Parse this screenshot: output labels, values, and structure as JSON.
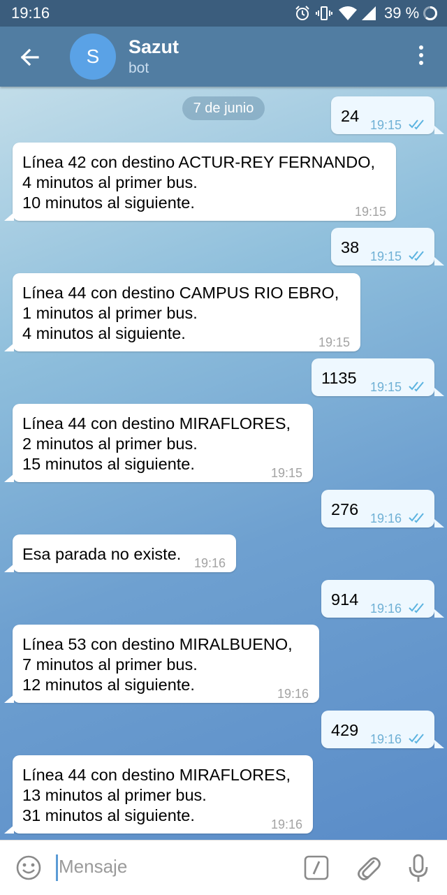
{
  "status_bar": {
    "time": "19:16",
    "battery": "39 %"
  },
  "header": {
    "avatar_letter": "S",
    "title": "Sazut",
    "subtitle": "bot"
  },
  "date_separator": "7 de junio",
  "messages": [
    {
      "dir": "out",
      "text": "24",
      "time": "19:15",
      "read": true
    },
    {
      "dir": "in",
      "text": "Línea 42 con destino ACTUR-REY FERNANDO,\n4 minutos al primer bus.\n10 minutos al siguiente.",
      "time": "19:15"
    },
    {
      "dir": "out",
      "text": "38",
      "time": "19:15",
      "read": true
    },
    {
      "dir": "in",
      "text": "Línea 44 con destino CAMPUS RIO EBRO,\n1 minutos al primer bus.\n4 minutos al siguiente.",
      "time": "19:15"
    },
    {
      "dir": "out",
      "text": "1135",
      "time": "19:15",
      "read": true
    },
    {
      "dir": "in",
      "text": "Línea 44 con destino MIRAFLORES,\n2 minutos al primer bus.\n15 minutos al siguiente.",
      "time": "19:15"
    },
    {
      "dir": "out",
      "text": "276",
      "time": "19:16",
      "read": true
    },
    {
      "dir": "in",
      "text": "Esa parada no existe.",
      "time": "19:16"
    },
    {
      "dir": "out",
      "text": "914",
      "time": "19:16",
      "read": true
    },
    {
      "dir": "in",
      "text": "Línea 53 con destino MIRALBUENO,\n7 minutos al primer bus.\n12 minutos al siguiente.",
      "time": "19:16"
    },
    {
      "dir": "out",
      "text": "429",
      "time": "19:16",
      "read": true
    },
    {
      "dir": "in",
      "text": "Línea 44 con destino MIRAFLORES,\n13 minutos al primer bus.\n31 minutos al siguiente.",
      "time": "19:16"
    }
  ],
  "composer": {
    "placeholder": "Mensaje"
  },
  "icons": {
    "status": [
      "alarm-icon",
      "vibrate-icon",
      "wifi-icon",
      "signal-icon",
      "battery-icon"
    ],
    "header": [
      "back-arrow-icon",
      "more-vert-icon"
    ],
    "composer": [
      "emoji-icon",
      "bot-command-icon",
      "attach-icon",
      "mic-icon"
    ]
  },
  "colors": {
    "header": "#517da2",
    "status_bar": "#3b5d7d",
    "outgoing_bubble": "#eef8ff",
    "incoming_bubble": "#ffffff",
    "read_ticks": "#5bb3e0",
    "avatar": "#5aa2e6"
  }
}
